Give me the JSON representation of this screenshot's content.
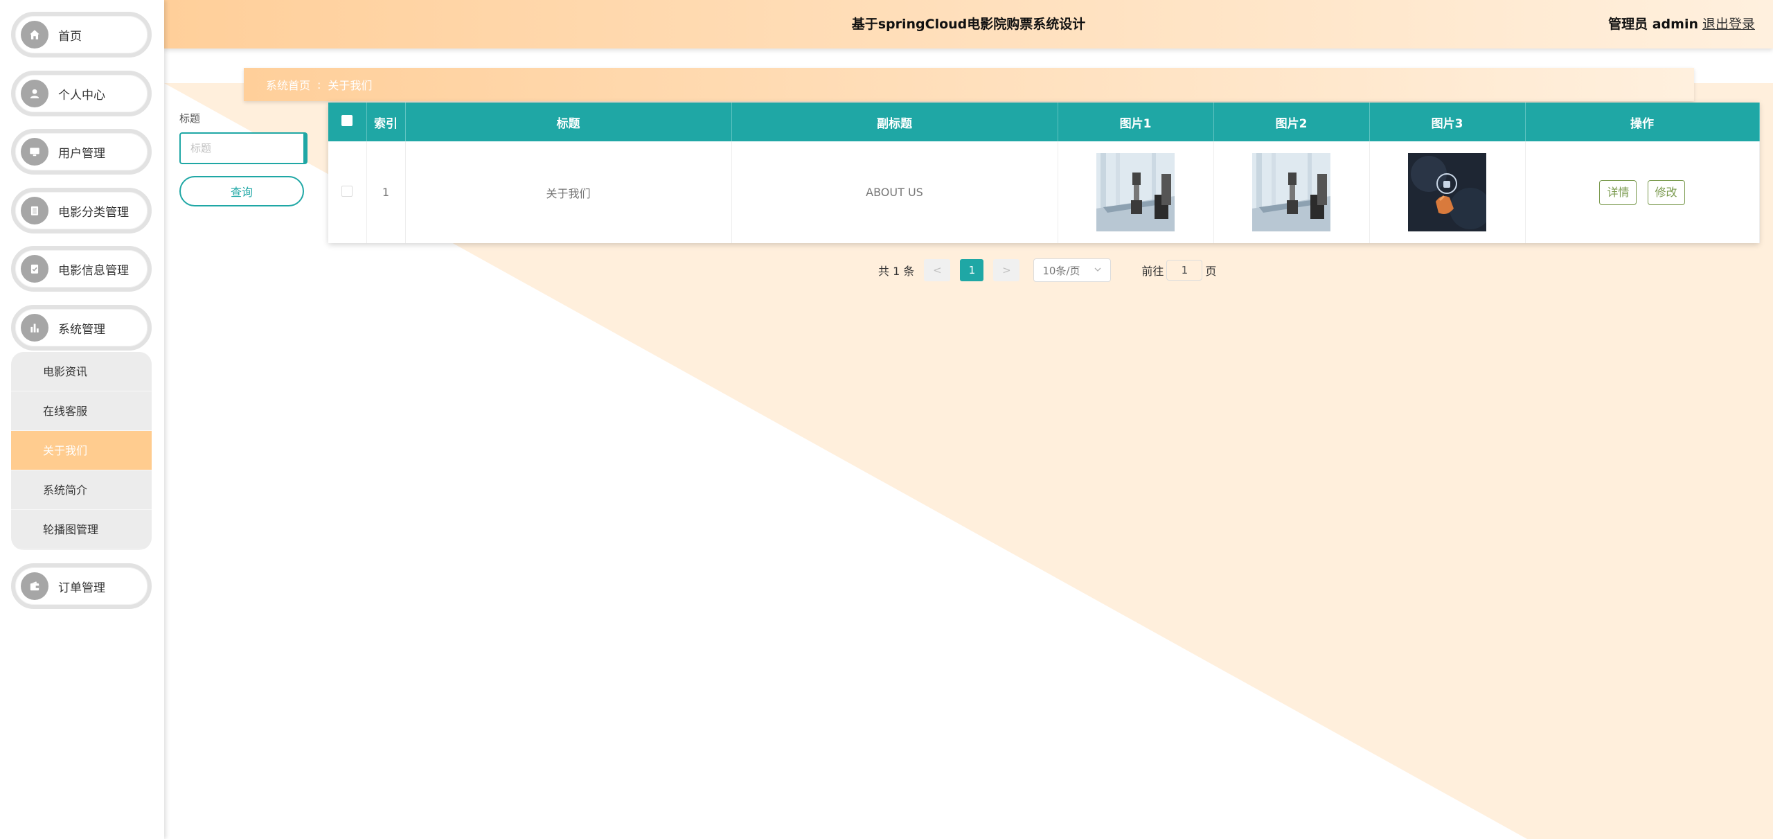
{
  "header": {
    "title": "基于springCloud电影院购票系统设计",
    "user": "管理员 admin",
    "logout": "退出登录"
  },
  "sidebar": {
    "items": [
      {
        "label": "首页",
        "icon": "home-icon"
      },
      {
        "label": "个人中心",
        "icon": "user-icon"
      },
      {
        "label": "用户管理",
        "icon": "monitor-icon"
      },
      {
        "label": "电影分类管理",
        "icon": "clipboard-icon"
      },
      {
        "label": "电影信息管理",
        "icon": "clipboard-check-icon"
      },
      {
        "label": "系统管理",
        "icon": "chart-icon"
      },
      {
        "label": "订单管理",
        "icon": "wallet-icon"
      }
    ],
    "submenu": [
      {
        "label": "电影资讯",
        "active": false
      },
      {
        "label": "在线客服",
        "active": false
      },
      {
        "label": "关于我们",
        "active": true
      },
      {
        "label": "系统简介",
        "active": false
      },
      {
        "label": "轮播图管理",
        "active": false
      }
    ]
  },
  "breadcrumb": {
    "home": "系统首页",
    "separator": ":",
    "current": "关于我们"
  },
  "search": {
    "label": "标题",
    "placeholder": "标题",
    "button": "查询"
  },
  "table": {
    "headers": [
      "索引",
      "标题",
      "副标题",
      "图片1",
      "图片2",
      "图片3",
      "操作"
    ],
    "rows": [
      {
        "index": "1",
        "title": "关于我们",
        "subtitle": "ABOUT US",
        "detail_button": "详情",
        "edit_button": "修改"
      }
    ]
  },
  "pagination": {
    "total": "共 1 条",
    "prev": "<",
    "current": "1",
    "next": ">",
    "page_size": "10条/页",
    "goto_label": "前往",
    "goto_value": "1",
    "page_suffix": "页"
  },
  "colors": {
    "accent": "#1fa7a5",
    "header_gradient_start": "#ffcf9a",
    "header_gradient_end": "#fff0de",
    "active_menu": "#ffcc8f",
    "background_triangle": "#ffefdc"
  }
}
